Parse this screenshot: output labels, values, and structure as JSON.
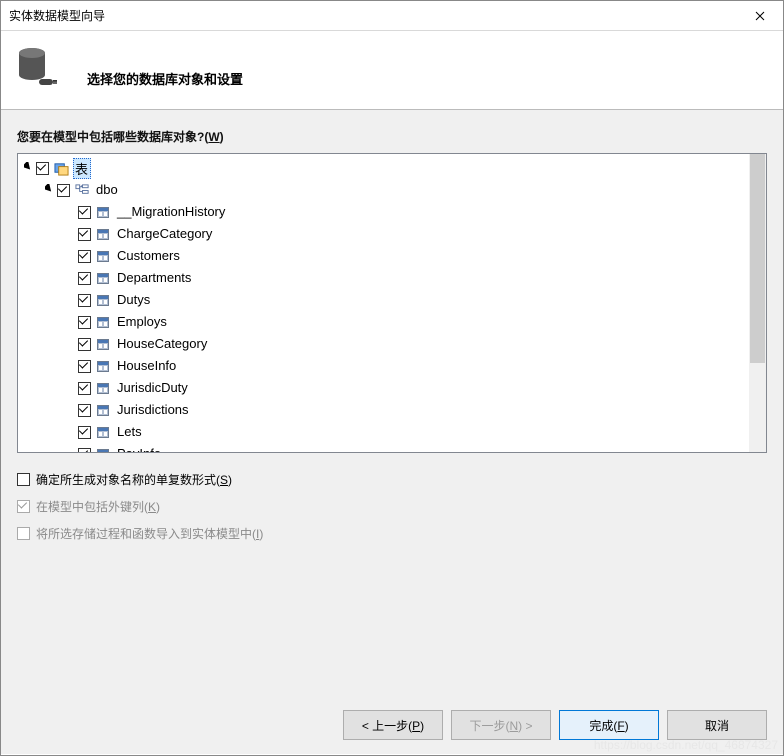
{
  "window": {
    "title": "实体数据模型向导"
  },
  "header": {
    "subtitle": "选择您的数据库对象和设置"
  },
  "question": {
    "prefix": "您要在模型中包括哪些数据库对象?(",
    "mnemonic": "W",
    "suffix": ")"
  },
  "tree": {
    "root": {
      "label": "表",
      "checked": true
    },
    "schema": {
      "label": "dbo",
      "checked": true
    },
    "tables": [
      {
        "label": "__MigrationHistory",
        "checked": true
      },
      {
        "label": "ChargeCategory",
        "checked": true
      },
      {
        "label": "Customers",
        "checked": true
      },
      {
        "label": "Departments",
        "checked": true
      },
      {
        "label": "Dutys",
        "checked": true
      },
      {
        "label": "Employs",
        "checked": true
      },
      {
        "label": "HouseCategory",
        "checked": true
      },
      {
        "label": "HouseInfo",
        "checked": true
      },
      {
        "label": "JurisdicDuty",
        "checked": true
      },
      {
        "label": "Jurisdictions",
        "checked": true
      },
      {
        "label": "Lets",
        "checked": true
      },
      {
        "label": "PayInfo",
        "checked": true
      }
    ]
  },
  "options": [
    {
      "prefix": "确定所生成对象名称的单复数形式(",
      "mnemonic": "S",
      "suffix": ")",
      "checked": false,
      "enabled": true
    },
    {
      "prefix": "在模型中包括外键列(",
      "mnemonic": "K",
      "suffix": ")",
      "checked": true,
      "enabled": false
    },
    {
      "prefix": "将所选存储过程和函数导入到实体模型中(",
      "mnemonic": "I",
      "suffix": ")",
      "checked": false,
      "enabled": false
    }
  ],
  "buttons": {
    "prev": {
      "prefix": "< 上一步(",
      "mnemonic": "P",
      "suffix": ")"
    },
    "next": {
      "prefix": "下一步(",
      "mnemonic": "N",
      "suffix": ") >"
    },
    "finish": {
      "prefix": "完成(",
      "mnemonic": "F",
      "suffix": ")"
    },
    "cancel": {
      "label": "取消"
    }
  }
}
